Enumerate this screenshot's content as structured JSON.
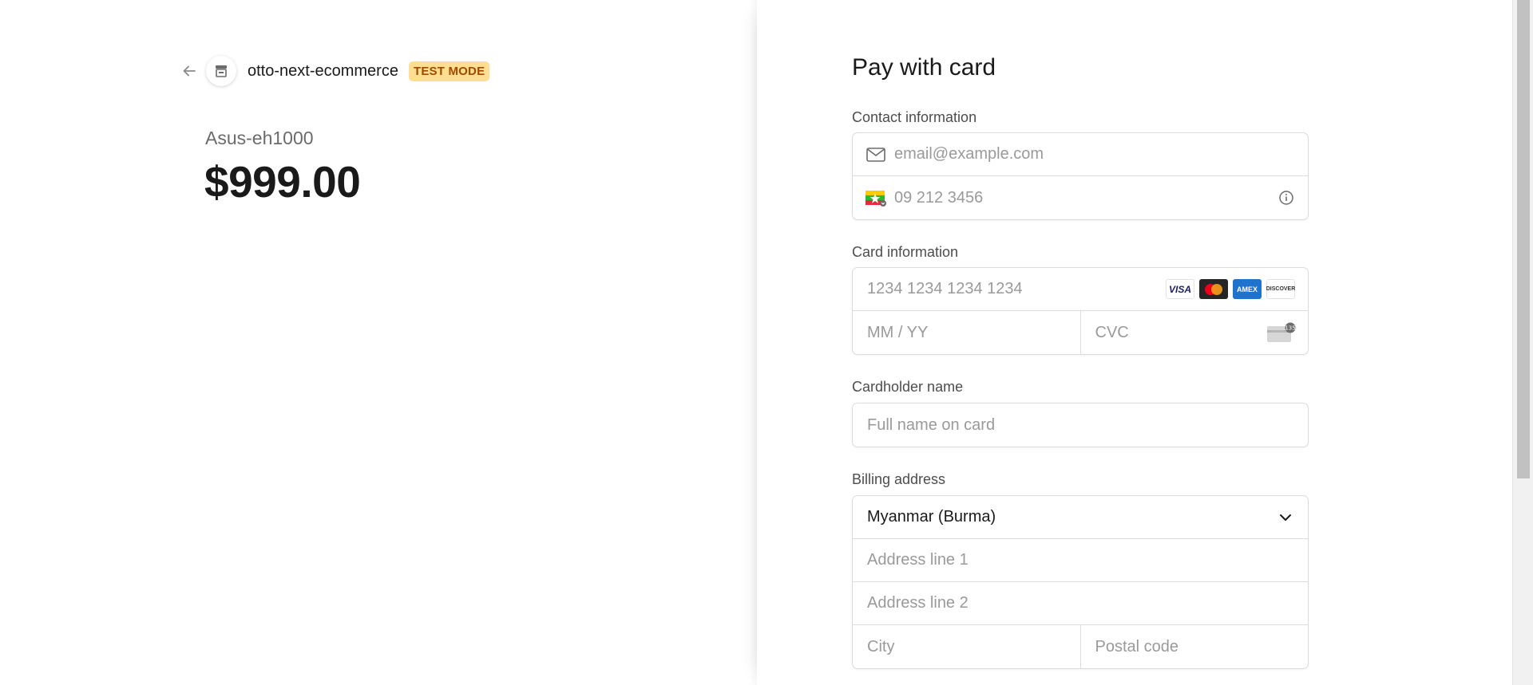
{
  "header": {
    "store_name": "otto-next-ecommerce",
    "badge": "TEST MODE"
  },
  "product": {
    "name": "Asus-eh1000",
    "price": "$999.00"
  },
  "form": {
    "title": "Pay with card",
    "contact": {
      "label": "Contact information",
      "email_placeholder": "email@example.com",
      "phone_placeholder": "09 212 3456"
    },
    "card": {
      "label": "Card information",
      "number_placeholder": "1234 1234 1234 1234",
      "expiry_placeholder": "MM / YY",
      "cvc_placeholder": "CVC",
      "brands": [
        "VISA",
        "Mastercard",
        "AMEX",
        "DISCOVER"
      ],
      "cvc_hint": "135"
    },
    "cardholder": {
      "label": "Cardholder name",
      "placeholder": "Full name on card"
    },
    "billing": {
      "label": "Billing address",
      "country": "Myanmar (Burma)",
      "address1_placeholder": "Address line 1",
      "address2_placeholder": "Address line 2",
      "city_placeholder": "City",
      "postal_placeholder": "Postal code"
    }
  },
  "icons": {
    "back": "back-arrow-icon",
    "store": "store-icon",
    "email": "envelope-icon",
    "phone_flag": "myanmar-flag-icon",
    "info": "info-icon",
    "cvc": "card-cvc-icon",
    "chevron": "chevron-down-icon"
  },
  "colors": {
    "badge_bg": "#ffde92",
    "badge_text": "#a04b00",
    "border": "#dcdcdc",
    "placeholder": "#9a9a9a"
  }
}
